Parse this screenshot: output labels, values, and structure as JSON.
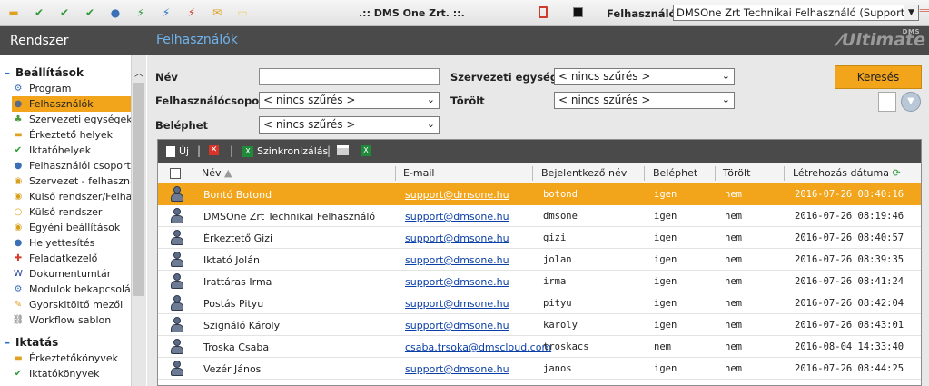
{
  "topbar": {
    "app_title": ".:: DMS One Zrt. ::.",
    "user_label": "Felhasználó:",
    "user_value": "DMSOne Zrt Technikai Felhasználó (Support)",
    "toolbar_icons": [
      "folder-icon",
      "check-icon",
      "check-icon",
      "check-icon",
      "users-icon",
      "bolt-green-icon",
      "bolt-blue-icon",
      "bolt-red-icon",
      "mail-icon",
      "note-icon"
    ]
  },
  "sidebar": {
    "title": "Rendszer",
    "section1": "Beállítások",
    "items": [
      {
        "label": "Program",
        "icon": "gears-icon",
        "color": "#3b6fb6"
      },
      {
        "label": "Felhasználók",
        "icon": "user-icon",
        "color": "#5b6b86"
      },
      {
        "label": "Szervezeti egységek",
        "icon": "org-icon",
        "color": "#4a9a3a"
      },
      {
        "label": "Érkeztető helyek",
        "icon": "inbox-icon",
        "color": "#e0a020"
      },
      {
        "label": "Iktatóhelyek",
        "icon": "check-icon",
        "color": "#2e9a3a"
      },
      {
        "label": "Felhasználói csoportok",
        "icon": "users-icon",
        "color": "#3b6fb6"
      },
      {
        "label": "Szervezet - felhasználó",
        "icon": "globe-icon",
        "color": "#d8a020"
      },
      {
        "label": "Külső rendszer/Felhasz",
        "icon": "globe-icon",
        "color": "#d8a020"
      },
      {
        "label": "Külső rendszer",
        "icon": "ring-icon",
        "color": "#e0a020"
      },
      {
        "label": "Egyéni beállítások",
        "icon": "globe-icon",
        "color": "#d8a020"
      },
      {
        "label": "Helyettesítés",
        "icon": "users-icon",
        "color": "#3b6fb6"
      },
      {
        "label": "Feladatkezelő",
        "icon": "tasks-icon",
        "color": "#d33a2a"
      },
      {
        "label": "Dokumentumtár",
        "icon": "word-icon",
        "color": "#1f3f9a"
      },
      {
        "label": "Modulok bekapcsolása",
        "icon": "gears-icon",
        "color": "#3b6fb6"
      },
      {
        "label": "Gyorskitöltő mezői",
        "icon": "pencil-icon",
        "color": "#e0a020"
      },
      {
        "label": "Workflow sablon",
        "icon": "flow-icon",
        "color": "#555555"
      }
    ],
    "section2": "Iktatás",
    "items2": [
      {
        "label": "Érkeztetőkönyvek",
        "icon": "inbox-icon",
        "color": "#e0a020"
      },
      {
        "label": "Iktatókönyvek",
        "icon": "check-icon",
        "color": "#2e9a3a"
      }
    ]
  },
  "main": {
    "title": "Felhasználók",
    "logo": "Ultimate",
    "logo_small": "DMS"
  },
  "filters": {
    "nev_label": "Név",
    "nev_value": "",
    "csoport_label": "Felhasználócsoport",
    "csoport_value": "< nincs szűrés >",
    "belephet_label": "Beléphet",
    "belephet_value": "< nincs szűrés >",
    "szerv_label": "Szervezeti egység",
    "szerv_value": "< nincs szűrés >",
    "torolt_label": "Törölt",
    "torolt_value": "< nincs szűrés >",
    "search_label": "Keresés"
  },
  "grid": {
    "toolbar": {
      "new": "Új",
      "sync": "Szinkronizálás"
    },
    "columns": {
      "nev": "Név",
      "email": "E-mail",
      "login": "Bejelentkező név",
      "belephet": "Beléphet",
      "torolt": "Törölt",
      "created": "Létrehozás dátuma"
    },
    "rows": [
      {
        "nev": "Bontó Botond",
        "email": "support@dmsone.hu",
        "login": "botond",
        "belephet": "igen",
        "torolt": "nem",
        "created": "2016-07-26 08:40:16"
      },
      {
        "nev": "DMSOne Zrt Technikai Felhasználó",
        "email": "support@dmsone.hu",
        "login": "dmsone",
        "belephet": "igen",
        "torolt": "nem",
        "created": "2016-07-26 08:19:46"
      },
      {
        "nev": "Érkeztető Gizi",
        "email": "support@dmsone.hu",
        "login": "gizi",
        "belephet": "igen",
        "torolt": "nem",
        "created": "2016-07-26 08:40:57"
      },
      {
        "nev": "Iktató Jolán",
        "email": "support@dmsone.hu",
        "login": "jolan",
        "belephet": "igen",
        "torolt": "nem",
        "created": "2016-07-26 08:39:35"
      },
      {
        "nev": "Irattáras Irma",
        "email": "support@dmsone.hu",
        "login": "irma",
        "belephet": "igen",
        "torolt": "nem",
        "created": "2016-07-26 08:41:24"
      },
      {
        "nev": "Postás Pityu",
        "email": "support@dmsone.hu",
        "login": "pityu",
        "belephet": "igen",
        "torolt": "nem",
        "created": "2016-07-26 08:42:04"
      },
      {
        "nev": "Szignáló Károly",
        "email": "support@dmsone.hu",
        "login": "karoly",
        "belephet": "igen",
        "torolt": "nem",
        "created": "2016-07-26 08:43:01"
      },
      {
        "nev": "Troska Csaba",
        "email": "csaba.trsoka@dmscloud.com",
        "login": "troskacs",
        "belephet": "nem",
        "torolt": "nem",
        "created": "2016-08-04 14:33:40"
      },
      {
        "nev": "Vezér János",
        "email": "support@dmsone.hu",
        "login": "janos",
        "belephet": "igen",
        "torolt": "nem",
        "created": "2016-07-26 08:44:25"
      }
    ]
  }
}
